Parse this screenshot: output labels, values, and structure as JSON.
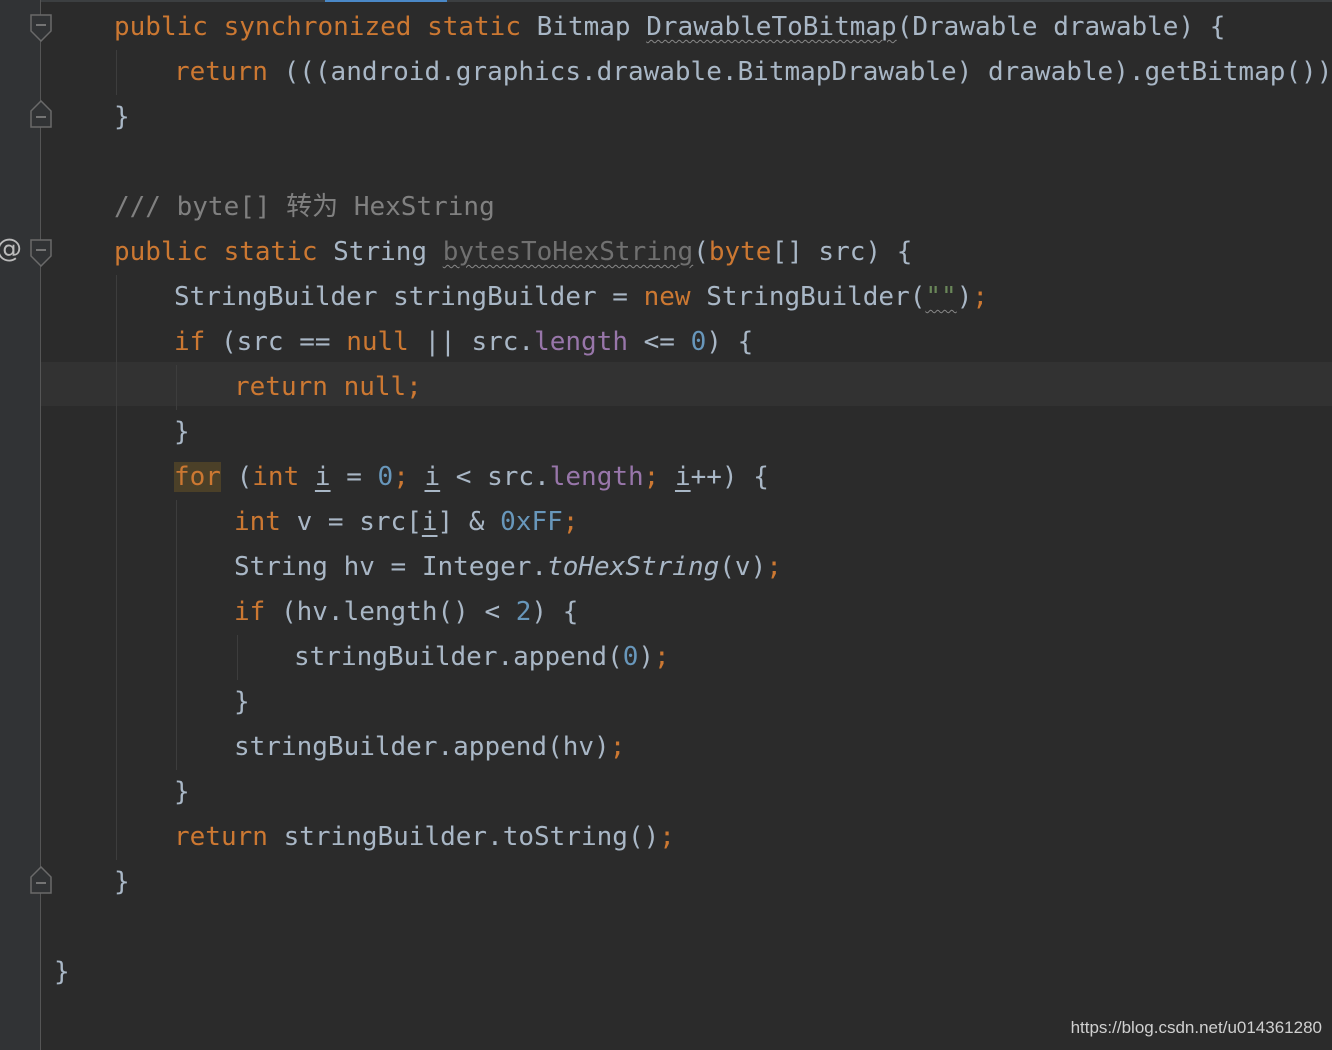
{
  "editor": {
    "lines": {
      "l1": {
        "t1": "public synchronized static",
        "t2": " Bitmap ",
        "t3": "DrawableToBitmap",
        "t4": "(Drawable drawable) {"
      },
      "l2": {
        "t1": "return",
        "t2": " (((android.graphics.drawable.BitmapDrawable) drawable).getBitmap())",
        "t3": ";"
      },
      "l3": {
        "t1": "}"
      },
      "l4": {
        "t1": "/// byte[] 转为 HexString"
      },
      "l5": {
        "t1": "public static",
        "t2": " String ",
        "t3": "bytesToHexString",
        "t4": "(",
        "t5": "byte",
        "t6": "[] src) {"
      },
      "l6": {
        "t1": "StringBuilder stringBuilder = ",
        "t2": "new",
        "t3": " StringBuilder(",
        "t4": "\"\"",
        "t5": ")",
        "t6": ";"
      },
      "l7": {
        "t1": "if",
        "t2": " (src == ",
        "t3": "null",
        "t4": " || src.",
        "t5": "length",
        "t6": " <= ",
        "t7": "0",
        "t8": ") {"
      },
      "l8": {
        "t1": "return null;"
      },
      "l9": {
        "t1": "}"
      },
      "l10": {
        "t1": "for",
        "t2": " (",
        "t3": "int",
        "t4": " ",
        "t5": "i",
        "t6": " = ",
        "t7": "0",
        "t8": "; ",
        "t9": "i",
        "t10": " < src.",
        "t11": "length",
        "t12": "; ",
        "t13": "i",
        "t14": "++) {"
      },
      "l11": {
        "t1": "int",
        "t2": " v = src[",
        "t3": "i",
        "t4": "] & ",
        "t5": "0xFF",
        "t6": ";"
      },
      "l12": {
        "t1": "String hv = Integer.",
        "t2": "toHexString",
        "t3": "(v)",
        "t4": ";"
      },
      "l13": {
        "t1": "if",
        "t2": " (hv.length() < ",
        "t3": "2",
        "t4": ") {"
      },
      "l14": {
        "t1": "stringBuilder.append(",
        "t2": "0",
        "t3": ")",
        "t4": ";"
      },
      "l15": {
        "t1": "}"
      },
      "l16": {
        "t1": "stringBuilder.append(hv)",
        "t2": ";"
      },
      "l17": {
        "t1": "}"
      },
      "l18": {
        "t1": "return",
        "t2": " stringBuilder.toString()",
        "t3": ";"
      },
      "l19": {
        "t1": "}"
      },
      "l20": {
        "t1": "}"
      }
    }
  },
  "gutter": {
    "override_icon": "@",
    "fold_icons": [
      "fold-start-icon",
      "fold-end-icon"
    ]
  },
  "watermark": "https://blog.csdn.net/u014361280",
  "colors": {
    "background": "#2b2b2b",
    "keyword": "#cc7832",
    "number": "#6897bb",
    "field": "#9876aa",
    "comment": "#808080",
    "text": "#a9b7c6"
  }
}
